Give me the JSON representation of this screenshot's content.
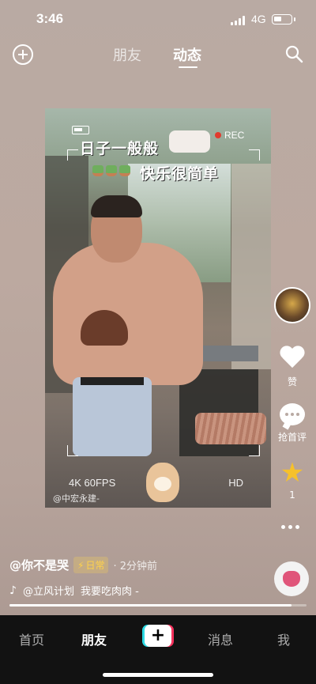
{
  "status_bar": {
    "time": "3:46",
    "network": "4G"
  },
  "top_nav": {
    "tabs": [
      {
        "label": "朋友"
      },
      {
        "label": "动态"
      }
    ]
  },
  "post": {
    "sticker_text_line1": "日子一般般",
    "sticker_text_line2": "快乐很简单",
    "camera_rec": "REC",
    "camera_fps": "4K 60FPS",
    "camera_hd": "HD",
    "watermark": "@中宏永建-",
    "author": "@你不是哭",
    "tag": "日常",
    "time_ago": "· 2分钟前",
    "music_source": "@立风计划",
    "music_title": "我要吃肉肉 -",
    "progress_fraction": 0.95
  },
  "actions": {
    "like_label": "赞",
    "comment_label": "抢首评",
    "favorite_count": "1"
  },
  "bottom_nav": {
    "home": "首页",
    "friends": "朋友",
    "create": "+",
    "messages": "消息",
    "me": "我"
  },
  "colors": {
    "accent_star": "#f6c12b",
    "tag_yellow": "#ffd24a",
    "rec_red": "#e23a2e"
  }
}
